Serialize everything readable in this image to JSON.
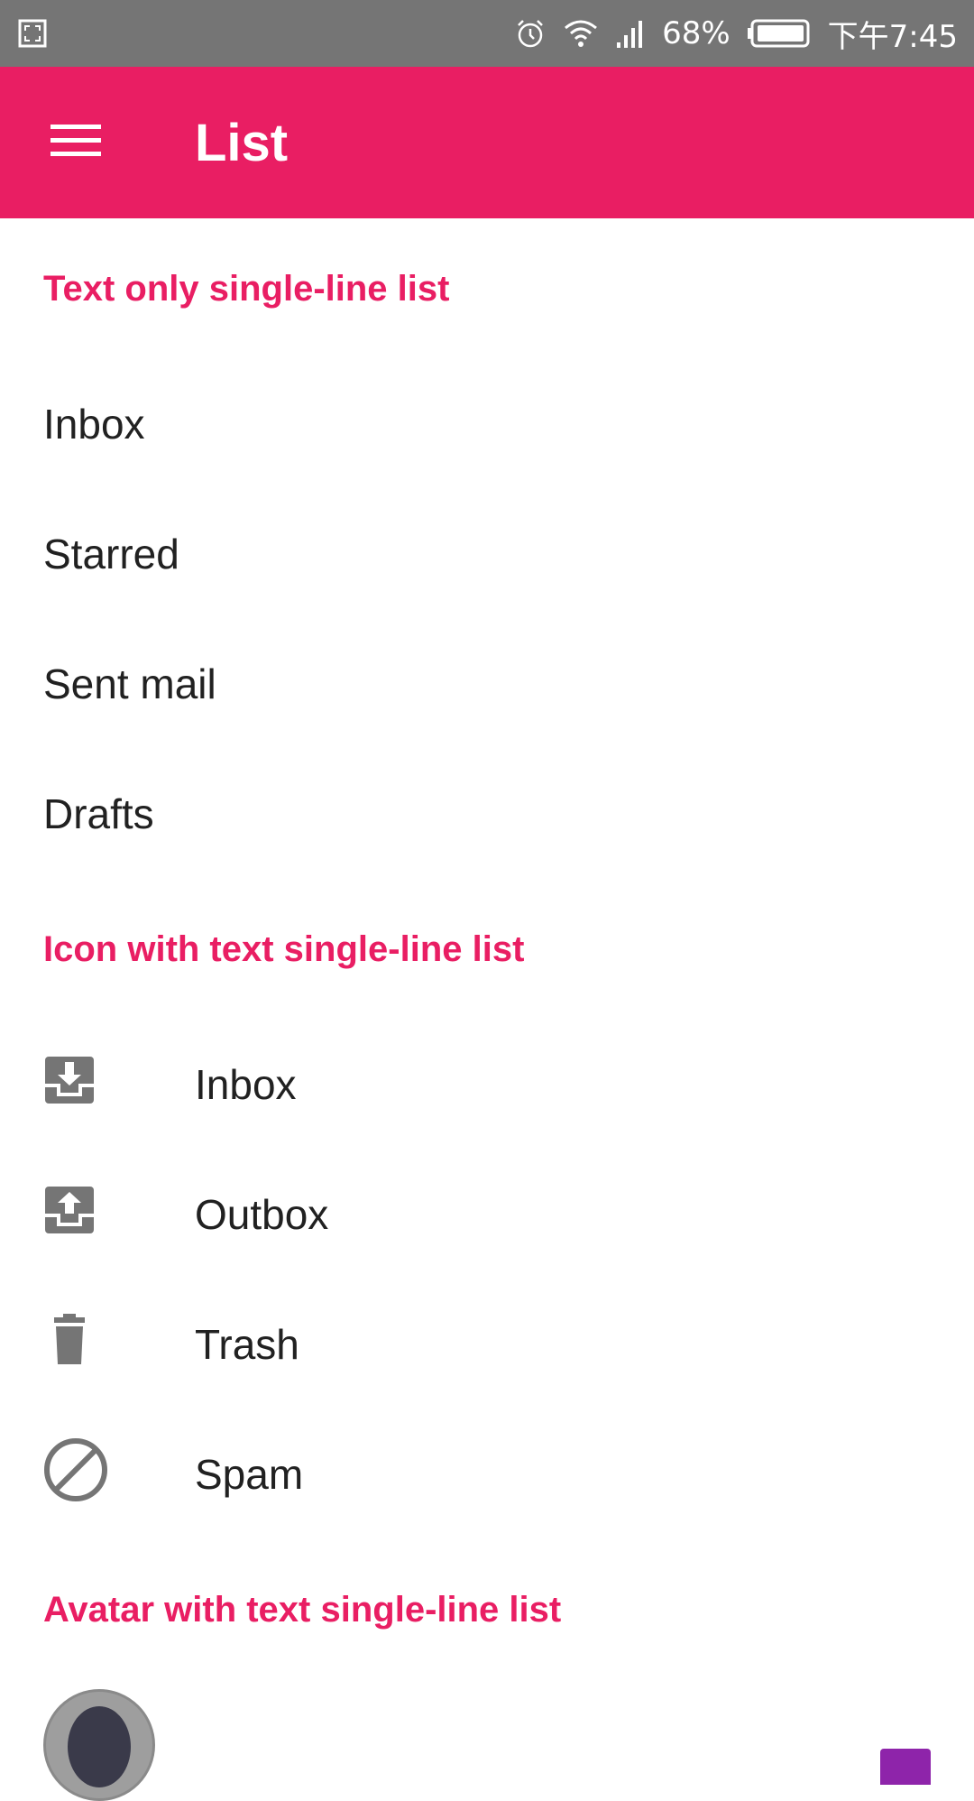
{
  "status_bar": {
    "battery": "68%",
    "time": "下午7:45"
  },
  "app_bar": {
    "title": "List"
  },
  "sections": {
    "text_only": {
      "header": "Text only single-line list",
      "items": [
        "Inbox",
        "Starred",
        "Sent mail",
        "Drafts"
      ]
    },
    "icon_with_text": {
      "header": "Icon with text single-line list",
      "items": [
        {
          "label": "Inbox",
          "icon": "inbox-icon"
        },
        {
          "label": "Outbox",
          "icon": "outbox-icon"
        },
        {
          "label": "Trash",
          "icon": "trash-icon"
        },
        {
          "label": "Spam",
          "icon": "spam-icon"
        }
      ]
    },
    "avatar_with_text": {
      "header": "Avatar with text single-line list"
    }
  },
  "colors": {
    "primary": "#e91e63",
    "status_bar": "#757575",
    "icon": "#757575",
    "text": "#212121",
    "accent_checkbox": "#8e24aa"
  }
}
